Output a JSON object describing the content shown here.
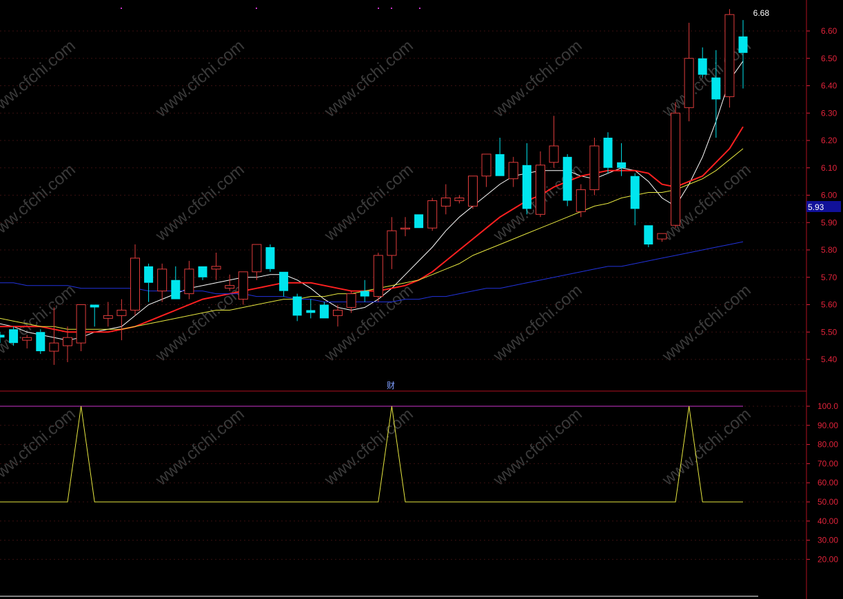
{
  "chart_data": [
    {
      "type": "candlestick",
      "title": "",
      "ylim": [
        5.35,
        6.72
      ],
      "yticks": [
        5.4,
        5.5,
        5.6,
        5.7,
        5.8,
        5.9,
        6.0,
        6.1,
        6.2,
        6.3,
        6.4,
        6.5,
        6.6
      ],
      "ytick_labels": [
        "5.40",
        "5.50",
        "5.60",
        "5.70",
        "5.80",
        "5.90",
        "6.00",
        "6.10",
        "6.20",
        "6.30",
        "6.40",
        "6.50",
        "6.60"
      ],
      "grid": "dotted-horizontal",
      "high_label": "6.68",
      "current_price_label": "5.93",
      "current_price": 5.93,
      "marker_label": "财",
      "colors": {
        "up": "#e03c3c",
        "down": "#00e5ee",
        "ma5": "#ffffff",
        "ma10": "#ff2020",
        "ma20": "#e8e840",
        "ma60": "#2233dd",
        "price_tag_bg": "#111199"
      },
      "candles": [
        {
          "o": 5.49,
          "h": 5.5,
          "l": 5.46,
          "c": 5.48
        },
        {
          "o": 5.51,
          "h": 5.52,
          "l": 5.45,
          "c": 5.46
        },
        {
          "o": 5.47,
          "h": 5.49,
          "l": 5.44,
          "c": 5.48
        },
        {
          "o": 5.5,
          "h": 5.51,
          "l": 5.42,
          "c": 5.43
        },
        {
          "o": 5.43,
          "h": 5.59,
          "l": 5.38,
          "c": 5.46
        },
        {
          "o": 5.45,
          "h": 5.52,
          "l": 5.39,
          "c": 5.48
        },
        {
          "o": 5.46,
          "h": 5.6,
          "l": 5.43,
          "c": 5.6
        },
        {
          "o": 5.6,
          "h": 5.6,
          "l": 5.52,
          "c": 5.59
        },
        {
          "o": 5.55,
          "h": 5.61,
          "l": 5.52,
          "c": 5.56
        },
        {
          "o": 5.56,
          "h": 5.62,
          "l": 5.47,
          "c": 5.58
        },
        {
          "o": 5.58,
          "h": 5.82,
          "l": 5.56,
          "c": 5.77
        },
        {
          "o": 5.74,
          "h": 5.75,
          "l": 5.61,
          "c": 5.68
        },
        {
          "o": 5.65,
          "h": 5.75,
          "l": 5.61,
          "c": 5.73
        },
        {
          "o": 5.69,
          "h": 5.74,
          "l": 5.62,
          "c": 5.62
        },
        {
          "o": 5.64,
          "h": 5.76,
          "l": 5.62,
          "c": 5.73
        },
        {
          "o": 5.74,
          "h": 5.74,
          "l": 5.69,
          "c": 5.7
        },
        {
          "o": 5.73,
          "h": 5.79,
          "l": 5.69,
          "c": 5.74
        },
        {
          "o": 5.66,
          "h": 5.71,
          "l": 5.65,
          "c": 5.67
        },
        {
          "o": 5.62,
          "h": 5.72,
          "l": 5.6,
          "c": 5.72
        },
        {
          "o": 5.72,
          "h": 5.82,
          "l": 5.69,
          "c": 5.82
        },
        {
          "o": 5.81,
          "h": 5.82,
          "l": 5.72,
          "c": 5.73
        },
        {
          "o": 5.72,
          "h": 5.72,
          "l": 5.63,
          "c": 5.65
        },
        {
          "o": 5.63,
          "h": 5.64,
          "l": 5.54,
          "c": 5.56
        },
        {
          "o": 5.58,
          "h": 5.62,
          "l": 5.55,
          "c": 5.57
        },
        {
          "o": 5.6,
          "h": 5.61,
          "l": 5.55,
          "c": 5.55
        },
        {
          "o": 5.56,
          "h": 5.6,
          "l": 5.52,
          "c": 5.58
        },
        {
          "o": 5.59,
          "h": 5.65,
          "l": 5.57,
          "c": 5.64
        },
        {
          "o": 5.65,
          "h": 5.69,
          "l": 5.61,
          "c": 5.63
        },
        {
          "o": 5.63,
          "h": 5.79,
          "l": 5.61,
          "c": 5.78
        },
        {
          "o": 5.78,
          "h": 5.92,
          "l": 5.73,
          "c": 5.87
        },
        {
          "o": 5.88,
          "h": 5.92,
          "l": 5.85,
          "c": 5.88
        },
        {
          "o": 5.93,
          "h": 5.93,
          "l": 5.88,
          "c": 5.88
        },
        {
          "o": 5.88,
          "h": 5.99,
          "l": 5.87,
          "c": 5.98
        },
        {
          "o": 5.96,
          "h": 6.04,
          "l": 5.93,
          "c": 5.99
        },
        {
          "o": 5.98,
          "h": 6.0,
          "l": 5.97,
          "c": 5.99
        },
        {
          "o": 5.96,
          "h": 6.07,
          "l": 5.95,
          "c": 6.07
        },
        {
          "o": 6.07,
          "h": 6.15,
          "l": 6.03,
          "c": 6.15
        },
        {
          "o": 6.15,
          "h": 6.21,
          "l": 6.07,
          "c": 6.07
        },
        {
          "o": 6.06,
          "h": 6.14,
          "l": 6.03,
          "c": 6.12
        },
        {
          "o": 6.11,
          "h": 6.19,
          "l": 5.93,
          "c": 5.95
        },
        {
          "o": 5.93,
          "h": 6.16,
          "l": 5.92,
          "c": 6.11
        },
        {
          "o": 6.12,
          "h": 6.29,
          "l": 6.1,
          "c": 6.18
        },
        {
          "o": 6.14,
          "h": 6.15,
          "l": 5.96,
          "c": 5.98
        },
        {
          "o": 5.94,
          "h": 6.04,
          "l": 5.92,
          "c": 6.02
        },
        {
          "o": 6.02,
          "h": 6.21,
          "l": 6.0,
          "c": 6.18
        },
        {
          "o": 6.21,
          "h": 6.23,
          "l": 6.08,
          "c": 6.1
        },
        {
          "o": 6.12,
          "h": 6.19,
          "l": 6.07,
          "c": 6.1
        },
        {
          "o": 6.07,
          "h": 6.08,
          "l": 5.89,
          "c": 5.95
        },
        {
          "o": 5.89,
          "h": 5.89,
          "l": 5.81,
          "c": 5.82
        },
        {
          "o": 5.84,
          "h": 5.86,
          "l": 5.83,
          "c": 5.86
        },
        {
          "o": 5.89,
          "h": 6.34,
          "l": 5.88,
          "c": 6.3
        },
        {
          "o": 6.32,
          "h": 6.63,
          "l": 6.27,
          "c": 6.5
        },
        {
          "o": 6.5,
          "h": 6.54,
          "l": 6.43,
          "c": 6.44
        },
        {
          "o": 6.43,
          "h": 6.53,
          "l": 6.21,
          "c": 6.35
        },
        {
          "o": 6.36,
          "h": 6.68,
          "l": 6.32,
          "c": 6.66
        },
        {
          "o": 6.58,
          "h": 6.64,
          "l": 6.39,
          "c": 6.52
        }
      ],
      "ma": [
        {
          "name": "",
          "values": [
            5.53,
            5.52,
            5.5,
            5.49,
            5.48,
            5.47,
            5.48,
            5.5,
            5.51,
            5.52,
            5.56,
            5.6,
            5.62,
            5.64,
            5.66,
            5.67,
            5.68,
            5.69,
            5.7,
            5.7,
            5.71,
            5.71,
            5.69,
            5.66,
            5.62,
            5.59,
            5.58,
            5.59,
            5.62,
            5.66,
            5.71,
            5.76,
            5.81,
            5.87,
            5.92,
            5.96,
            6.0,
            6.04,
            6.07,
            6.08,
            6.09,
            6.09,
            6.09,
            6.07,
            6.06,
            6.08,
            6.1,
            6.09,
            6.05,
            5.99,
            5.96,
            6.04,
            6.14,
            6.27,
            6.42,
            6.49
          ]
        },
        {
          "name": "",
          "values": [
            5.52,
            5.52,
            5.52,
            5.52,
            5.51,
            5.5,
            5.5,
            5.5,
            5.5,
            5.51,
            5.52,
            5.54,
            5.56,
            5.58,
            5.6,
            5.62,
            5.63,
            5.64,
            5.65,
            5.66,
            5.67,
            5.68,
            5.68,
            5.68,
            5.67,
            5.66,
            5.65,
            5.65,
            5.65,
            5.66,
            5.67,
            5.69,
            5.72,
            5.76,
            5.8,
            5.84,
            5.88,
            5.92,
            5.95,
            5.98,
            6.0,
            6.03,
            6.05,
            6.07,
            6.08,
            6.09,
            6.09,
            6.09,
            6.08,
            6.04,
            6.03,
            6.05,
            6.07,
            6.12,
            6.17,
            6.25
          ]
        },
        {
          "name": "",
          "values": [
            5.55,
            5.54,
            5.53,
            5.52,
            5.52,
            5.51,
            5.51,
            5.51,
            5.51,
            5.51,
            5.52,
            5.53,
            5.54,
            5.55,
            5.56,
            5.57,
            5.58,
            5.58,
            5.59,
            5.6,
            5.61,
            5.62,
            5.62,
            5.63,
            5.63,
            5.64,
            5.64,
            5.65,
            5.66,
            5.67,
            5.68,
            5.69,
            5.71,
            5.73,
            5.75,
            5.78,
            5.8,
            5.82,
            5.84,
            5.86,
            5.88,
            5.9,
            5.92,
            5.94,
            5.96,
            5.97,
            5.99,
            6.0,
            6.01,
            6.01,
            6.02,
            6.04,
            6.06,
            6.09,
            6.13,
            6.17
          ]
        },
        {
          "name": "",
          "values": [
            5.68,
            5.68,
            5.67,
            5.67,
            5.67,
            5.67,
            5.66,
            5.66,
            5.66,
            5.66,
            5.66,
            5.65,
            5.65,
            5.65,
            5.65,
            5.65,
            5.64,
            5.64,
            5.64,
            5.63,
            5.63,
            5.63,
            5.62,
            5.62,
            5.61,
            5.61,
            5.61,
            5.61,
            5.61,
            5.61,
            5.62,
            5.62,
            5.63,
            5.63,
            5.64,
            5.65,
            5.66,
            5.66,
            5.67,
            5.68,
            5.69,
            5.7,
            5.71,
            5.72,
            5.73,
            5.74,
            5.74,
            5.75,
            5.76,
            5.77,
            5.78,
            5.79,
            5.8,
            5.81,
            5.82,
            5.83
          ]
        }
      ]
    },
    {
      "type": "line",
      "title": "",
      "ylim": [
        0,
        105
      ],
      "yticks": [
        20,
        30,
        40,
        50,
        60,
        70,
        80,
        90,
        100
      ],
      "ytick_labels": [
        "20.00",
        "30.00",
        "40.00",
        "50.00",
        "60.00",
        "70.00",
        "80.00",
        "90.00",
        "100.0"
      ],
      "reference_line": 100,
      "colors": {
        "line": "#e8e840",
        "reference": "#cc33cc"
      },
      "series": [
        {
          "name": "",
          "values": [
            50,
            50,
            50,
            50,
            50,
            50,
            100,
            50,
            50,
            50,
            50,
            50,
            50,
            50,
            50,
            50,
            50,
            50,
            50,
            50,
            50,
            50,
            50,
            50,
            50,
            50,
            50,
            50,
            50,
            100,
            50,
            50,
            50,
            50,
            50,
            50,
            50,
            50,
            50,
            50,
            50,
            50,
            50,
            50,
            50,
            50,
            50,
            50,
            50,
            50,
            50,
            100,
            50,
            50,
            50,
            50
          ]
        }
      ]
    }
  ],
  "watermark": "www.cfchi.com"
}
